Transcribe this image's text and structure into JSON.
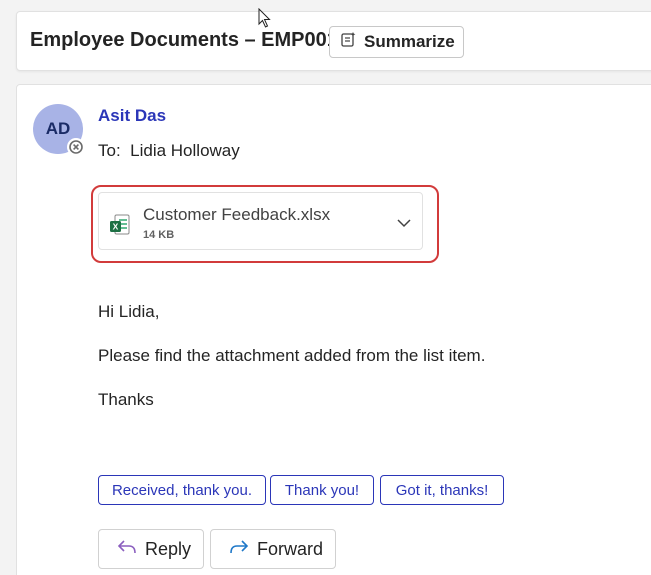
{
  "header": {
    "subject": "Employee Documents – EMP001",
    "summarize_label": "Summarize"
  },
  "message": {
    "avatar_initials": "AD",
    "sender": "Asit Das",
    "to_label": "To:",
    "recipient": "Lidia Holloway",
    "attachment": {
      "name": "Customer Feedback.xlsx",
      "size": "14 KB",
      "icon": "excel-file-icon"
    },
    "greeting": "Hi Lidia,",
    "body": "Please find the attachment added from the list item.",
    "closing": "Thanks"
  },
  "quick_replies": [
    "Received, thank you.",
    "Thank you!",
    "Got it, thanks!"
  ],
  "actions": {
    "reply_label": "Reply",
    "forward_label": "Forward"
  },
  "colors": {
    "accent": "#2b36b8",
    "highlight": "#d23b3b",
    "avatar_bg": "#a8b3e6",
    "excel_green": "#1d7044"
  }
}
